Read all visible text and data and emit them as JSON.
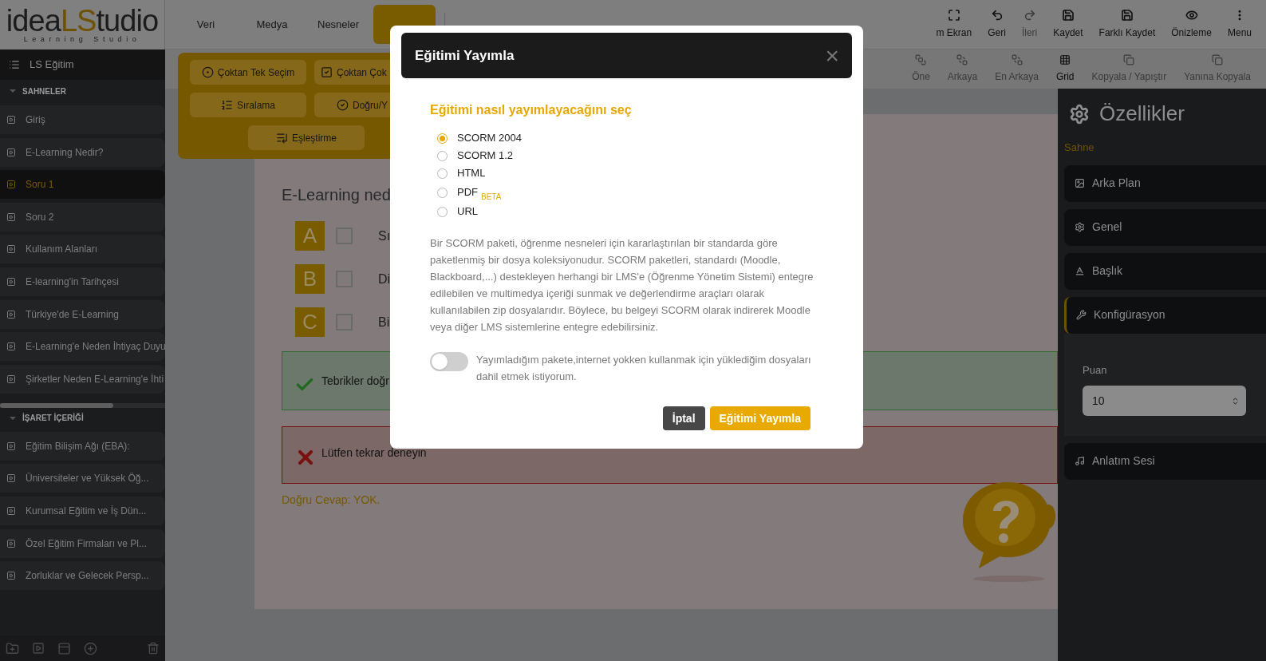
{
  "logo": {
    "lead": "idea",
    "accent": "LS",
    "tail": "tudio",
    "tagline": "Learning Studio"
  },
  "project": {
    "title": "LS Eğitim"
  },
  "scenes": {
    "title": "SAHNELER",
    "items": [
      {
        "label": "Giriş",
        "selected": false
      },
      {
        "label": "E-Learning Nedir?",
        "selected": false
      },
      {
        "label": "Soru 1",
        "selected": true
      },
      {
        "label": "Soru 2",
        "selected": false
      },
      {
        "label": "Kullanım Alanları",
        "selected": false
      },
      {
        "label": "E-learning'in Tarihçesi",
        "selected": false
      },
      {
        "label": "Türkiye'de E-Learning",
        "selected": false
      },
      {
        "label": "E-Learning'e Neden İhtiyaç Duyu",
        "selected": false
      },
      {
        "label": "Şirketler Neden E-Learning'e İhti",
        "selected": false
      }
    ]
  },
  "markers": {
    "title": "İŞARET İÇERİĞİ",
    "items": [
      {
        "label": "Eğitim Bilişim Ağı (EBA):",
        "selected": false
      },
      {
        "label": "Üniversiteler ve Yüksek Öğ...",
        "selected": false
      },
      {
        "label": "Kurumsal Eğitim ve İş Dün...",
        "selected": false
      },
      {
        "label": "Özel Eğitim Firmaları ve Pl...",
        "selected": false
      },
      {
        "label": "Zorluklar ve Gelecek Persp...",
        "selected": false
      }
    ]
  },
  "top_tabs": [
    {
      "label": "Veri",
      "selected": false
    },
    {
      "label": "Medya",
      "selected": false
    },
    {
      "label": "Nesneler",
      "selected": false
    },
    {
      "selected": true
    }
  ],
  "toolbar": [
    {
      "label": "m Ekran",
      "disabled": false
    },
    {
      "label": "Geri",
      "disabled": false
    },
    {
      "label": "İleri",
      "disabled": true
    },
    {
      "label": "Kaydet",
      "disabled": false
    },
    {
      "label": "Farklı Kaydet",
      "disabled": false
    },
    {
      "label": "Önizleme",
      "disabled": false
    },
    {
      "label": "Menu",
      "disabled": false
    }
  ],
  "toolbar_secondary": [
    {
      "label": "Öne",
      "disabled": true
    },
    {
      "label": "Arkaya",
      "disabled": true
    },
    {
      "label": "En Arkaya",
      "disabled": true
    },
    {
      "label": "Grid",
      "disabled": false
    },
    {
      "label": "Kopyala / Yapıştır",
      "disabled": true
    },
    {
      "label": "Yanına Kopyala",
      "disabled": true
    }
  ],
  "interaction_menu": [
    "Çoktan Tek Seçim",
    "Çoktan Çok",
    "Sıralama",
    "Doğru/Y",
    "Eşleştirme"
  ],
  "stage": {
    "question": "E-Learning ned",
    "options": [
      {
        "letter": "A",
        "text": "Sı",
        "checked": false
      },
      {
        "letter": "B",
        "text": "Di",
        "checked": false
      },
      {
        "letter": "C",
        "text": "Bi",
        "checked": false
      }
    ],
    "success": "Tebrikler doğr",
    "failure": "Lütfen tekrar deneyin",
    "answer": "Doğru Cevap: YOK."
  },
  "properties": {
    "title": "Özellikler",
    "section": "Sahne",
    "items": [
      {
        "label": "Arka Plan",
        "expanded": false
      },
      {
        "label": "Genel",
        "expanded": false
      },
      {
        "label": "Başlık",
        "expanded": false
      },
      {
        "label": "Konfigürasyon",
        "expanded": true,
        "field": {
          "label": "Puan",
          "value": "10"
        }
      },
      {
        "label": "Anlatım Sesi",
        "expanded": false
      }
    ]
  },
  "dialog": {
    "title": "Eğitimi Yayımla",
    "close": "×",
    "subtitle": "Eğitimi nasıl yayımlayacağını seç",
    "formats": [
      {
        "label": "SCORM 2004",
        "selected": true
      },
      {
        "label": "SCORM 1.2",
        "selected": false
      },
      {
        "label": "HTML",
        "selected": false
      },
      {
        "label": "PDF",
        "badge": "BETA",
        "selected": false
      },
      {
        "label": "URL",
        "selected": false
      }
    ],
    "description": "Bir SCORM paketi, öğrenme nesneleri için kararlaştırılan bir standarda göre paketlenmiş bir dosya koleksiyonudur. SCORM paketleri, standardı (Moodle, Blackboard,...) destekleyen herhangi bir LMS'e (Öğrenme Yönetim Sistemi) entegre edilebilen ve multimedya içeriği sunmak ve değerlendirme araçları olarak kullanılabilen zip dosyalarıdır. Böylece, bu belgeyi SCORM olarak indirerek Moodle veya diğer LMS sistemlerine entegre edebilirsiniz.",
    "offline_toggle": {
      "label": "Yayımladığım pakete,internet yokken kullanmak için yüklediğim dosyaları dahil etmek istiyorum.",
      "on": false
    },
    "buttons": [
      {
        "label": "İptal",
        "kind": "secondary"
      },
      {
        "label": "Eğitimi Yayımla",
        "kind": "primary"
      }
    ]
  }
}
